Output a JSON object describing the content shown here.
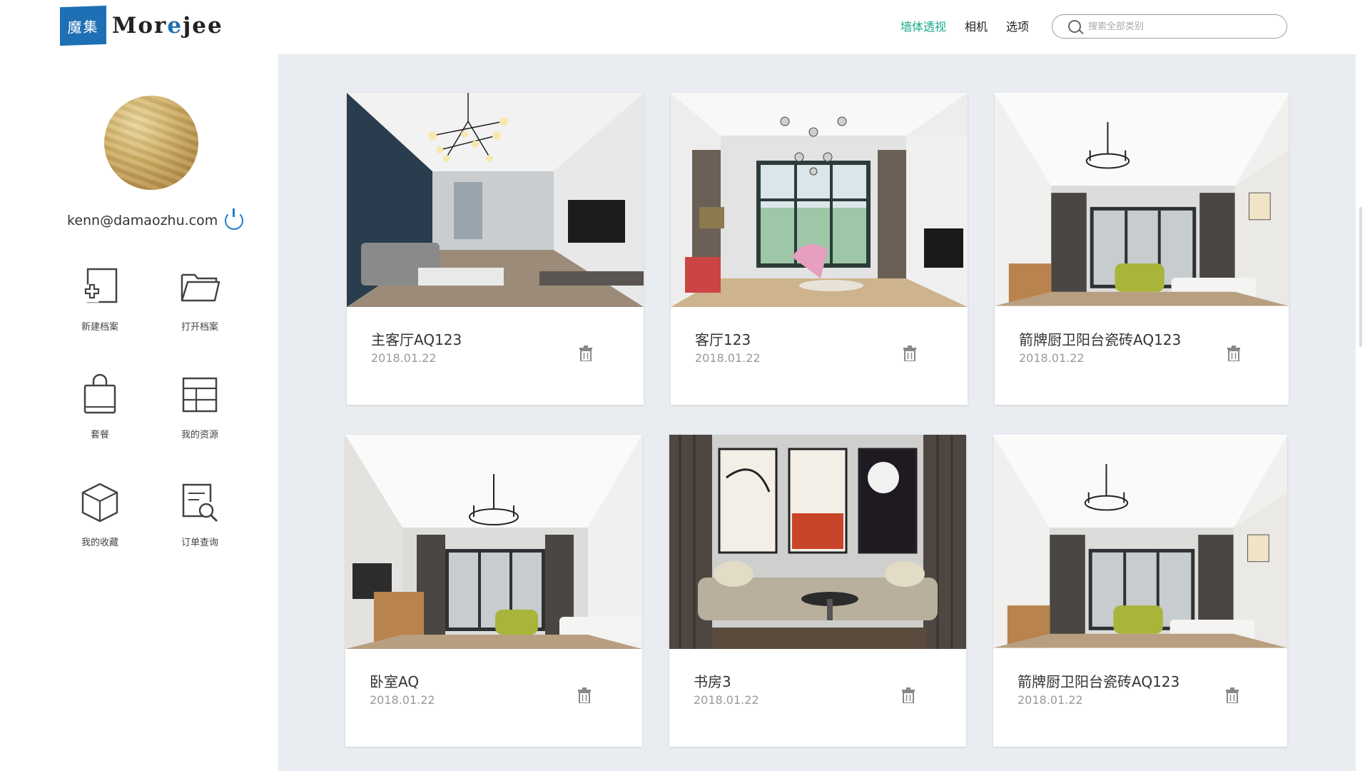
{
  "logo": {
    "mark": "魔集",
    "text_pre": "Mor",
    "text_o": "e",
    "text_post": "jee"
  },
  "nav": {
    "items": [
      {
        "label": "墙体透视",
        "active": true
      },
      {
        "label": "相机",
        "active": false
      },
      {
        "label": "选项",
        "active": false
      }
    ]
  },
  "search": {
    "placeholder": "搜索全部类别"
  },
  "user": {
    "email": "kenn@damaozhu.com"
  },
  "menu": [
    {
      "label": "新建档案",
      "icon": "new-file-icon"
    },
    {
      "label": "打开档案",
      "icon": "open-folder-icon"
    },
    {
      "label": "套餐",
      "icon": "shopping-bag-icon"
    },
    {
      "label": "我的资源",
      "icon": "grid-table-icon"
    },
    {
      "label": "我的收藏",
      "icon": "cube-icon"
    },
    {
      "label": "订单查询",
      "icon": "order-search-icon"
    }
  ],
  "cards": [
    {
      "title": "主客厅AQ123",
      "date": "2018.01.22",
      "scene": "dark-living"
    },
    {
      "title": "客厅123",
      "date": "2018.01.22",
      "scene": "window-living"
    },
    {
      "title": "箭牌厨卫阳台瓷砖AQ123",
      "date": "2018.01.22",
      "scene": "bright-living"
    },
    {
      "title": "卧室AQ",
      "date": "2018.01.22",
      "scene": "bright-living"
    },
    {
      "title": "书房3",
      "date": "2018.01.22",
      "scene": "study-art"
    },
    {
      "title": "箭牌厨卫阳台瓷砖AQ123",
      "date": "2018.01.22",
      "scene": "bright-living"
    }
  ],
  "colors": {
    "brand_blue": "#1f6fb5",
    "active_nav": "#19a98a",
    "main_bg": "#e9ecf0"
  }
}
